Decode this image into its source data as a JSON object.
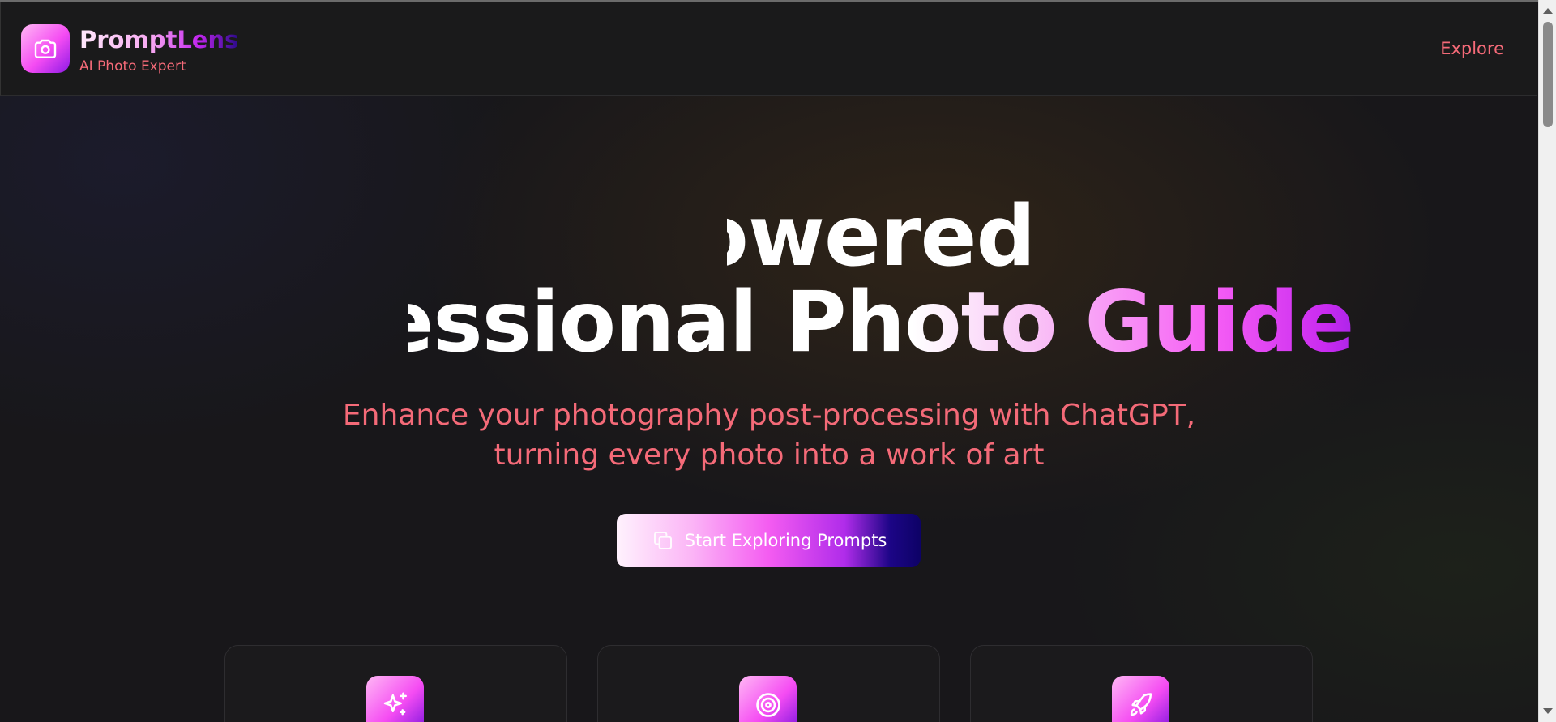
{
  "brand": {
    "name": "PromptLens",
    "tagline": "AI Photo Expert",
    "logo_icon": "camera-icon"
  },
  "nav": {
    "explore_label": "Explore"
  },
  "hero": {
    "title_line1": "AI-Powered",
    "title_line2": "Professional Photo Guide",
    "subtitle_line1": "Enhance your photography post-processing with ChatGPT,",
    "subtitle_line2": "turning every photo into a work of art",
    "cta_label": "Start Exploring Prompts",
    "cta_icon": "copy-icon"
  },
  "features": [
    {
      "icon": "sparkles-icon"
    },
    {
      "icon": "target-icon"
    },
    {
      "icon": "rocket-icon"
    }
  ],
  "colors": {
    "accent_coral": "#f46a78",
    "gradient_pink": "#f54cf3",
    "gradient_purple": "#8e1ae6",
    "gradient_navy": "#1e0a78",
    "background": "#18171a"
  }
}
